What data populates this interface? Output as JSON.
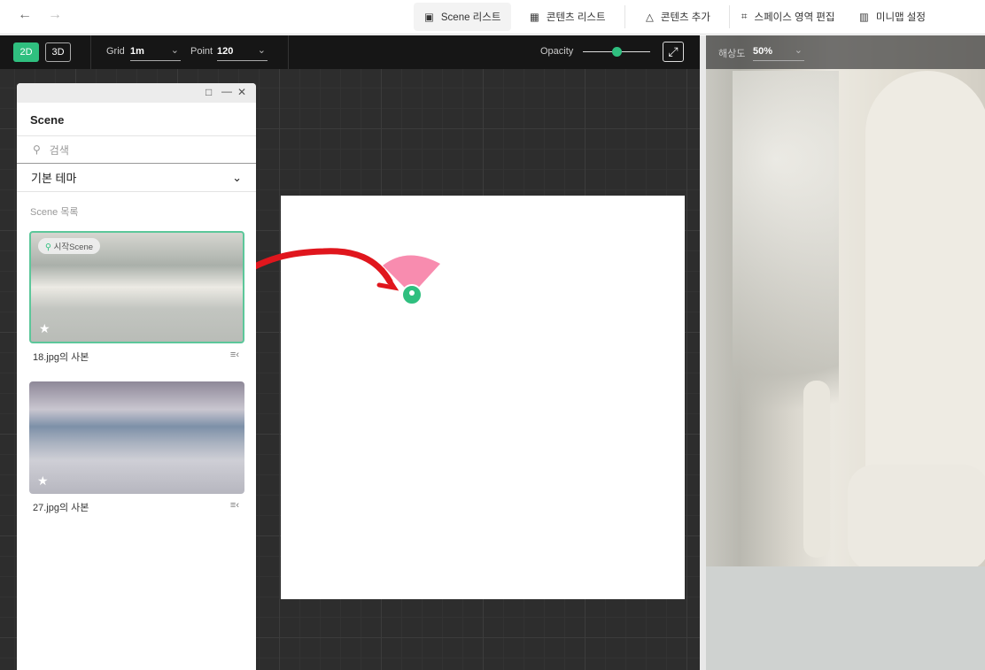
{
  "nav": {
    "back": "←",
    "forward": "→",
    "tabs": [
      {
        "label": "Scene 리스트",
        "icon": "image-icon",
        "active": true
      },
      {
        "label": "콘텐츠 리스트",
        "icon": "layout-icon"
      },
      {
        "label": "콘텐츠 추가",
        "icon": "shapes-icon"
      },
      {
        "label": "스페이스 영역 편집",
        "icon": "focus-icon"
      },
      {
        "label": "미니맵 설정",
        "icon": "map-icon"
      }
    ]
  },
  "toolbar": {
    "mode_2d": "2D",
    "mode_3d": "3D",
    "grid_label": "Grid",
    "grid_value": "1m",
    "point_label": "Point",
    "point_value": "120",
    "opacity_label": "Opacity",
    "opacity_value": 0.5
  },
  "preview": {
    "resolution_label": "해상도",
    "resolution_value": "50%"
  },
  "panel": {
    "title": "Scene",
    "search_placeholder": "검색",
    "theme": "기본 테마",
    "list_title": "Scene 목록",
    "scenes": [
      {
        "name": "18.jpg의 사본",
        "badge": "시작Scene",
        "selected": true
      },
      {
        "name": "27.jpg의 사본"
      }
    ]
  },
  "colors": {
    "accent": "#2fbf7f",
    "arrow": "#e0161d",
    "fan": "#f77fa6"
  }
}
